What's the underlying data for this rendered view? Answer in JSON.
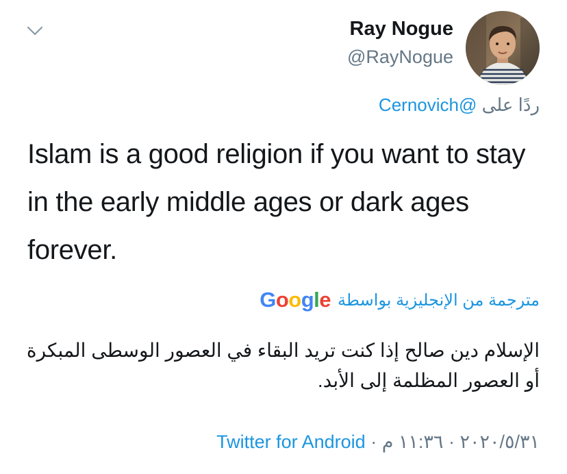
{
  "author": {
    "display_name": "Ray Nogue",
    "handle": "@RayNogue",
    "avatar_icon": "profile-photo"
  },
  "header": {
    "menu_icon": "chevron-down-icon"
  },
  "reply": {
    "prefix": "ردًا على",
    "mention": "@Cernovich"
  },
  "tweet": {
    "text": "Islam is a good religion if you want to stay in the early middle ages or dark ages forever."
  },
  "translation": {
    "label": "مترجمة من الإنجليزية بواسطة",
    "provider": "Google",
    "text": "الإسلام دين صالح إذا كنت تريد البقاء في العصور الوسطى المبكرة أو العصور المظلمة إلى الأبد."
  },
  "meta": {
    "date": "٢٠٢٠/٥/٣١",
    "time": "١١:٣٦ م",
    "separator": "·",
    "source": "Twitter for Android"
  },
  "colors": {
    "link": "#1b95e0",
    "secondary": "#657786",
    "primary_text": "#14171a"
  }
}
